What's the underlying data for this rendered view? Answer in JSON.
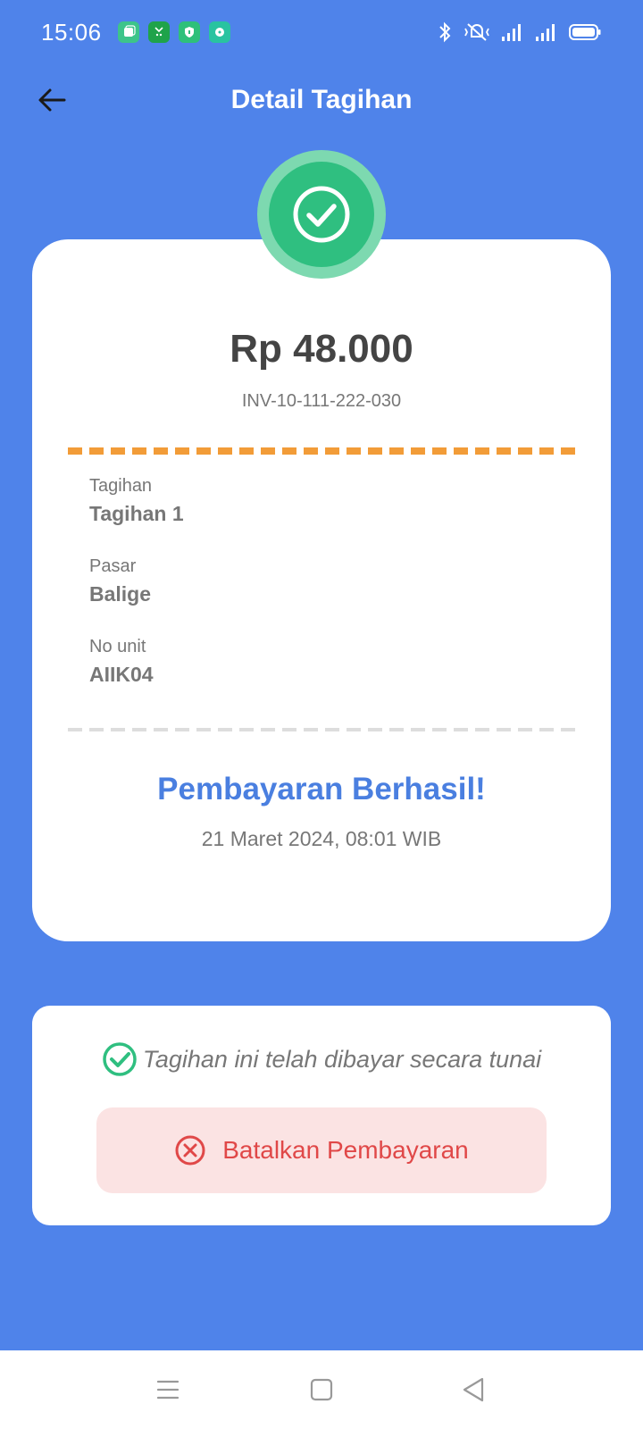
{
  "status_bar": {
    "time": "15:06",
    "notification_icons": [
      "app-icon-1",
      "app-icon-2",
      "shield-app-icon",
      "chat-app-icon"
    ],
    "system_icons": [
      "bluetooth-icon",
      "vibrate-icon",
      "signal-icon",
      "signal-icon",
      "battery-icon"
    ]
  },
  "header": {
    "title": "Detail Tagihan"
  },
  "receipt": {
    "amount": "Rp 48.000",
    "invoice_no": "INV-10-111-222-030",
    "details": [
      {
        "label": "Tagihan",
        "value": "Tagihan 1"
      },
      {
        "label": "Pasar",
        "value": "Balige"
      },
      {
        "label": "No unit",
        "value": "AIIK04"
      }
    ],
    "success_title": "Pembayaran Berhasil!",
    "success_date": "21 Maret 2024, 08:01 WIB"
  },
  "action": {
    "paid_note": "Tagihan ini telah dibayar secara tunai",
    "cancel_label": "Batalkan Pembayaran"
  },
  "colors": {
    "background": "#4F83EA",
    "success_green": "#2FBF80",
    "accent_orange": "#F29C38",
    "danger_red": "#E04848",
    "title_blue": "#4A7FE0"
  }
}
